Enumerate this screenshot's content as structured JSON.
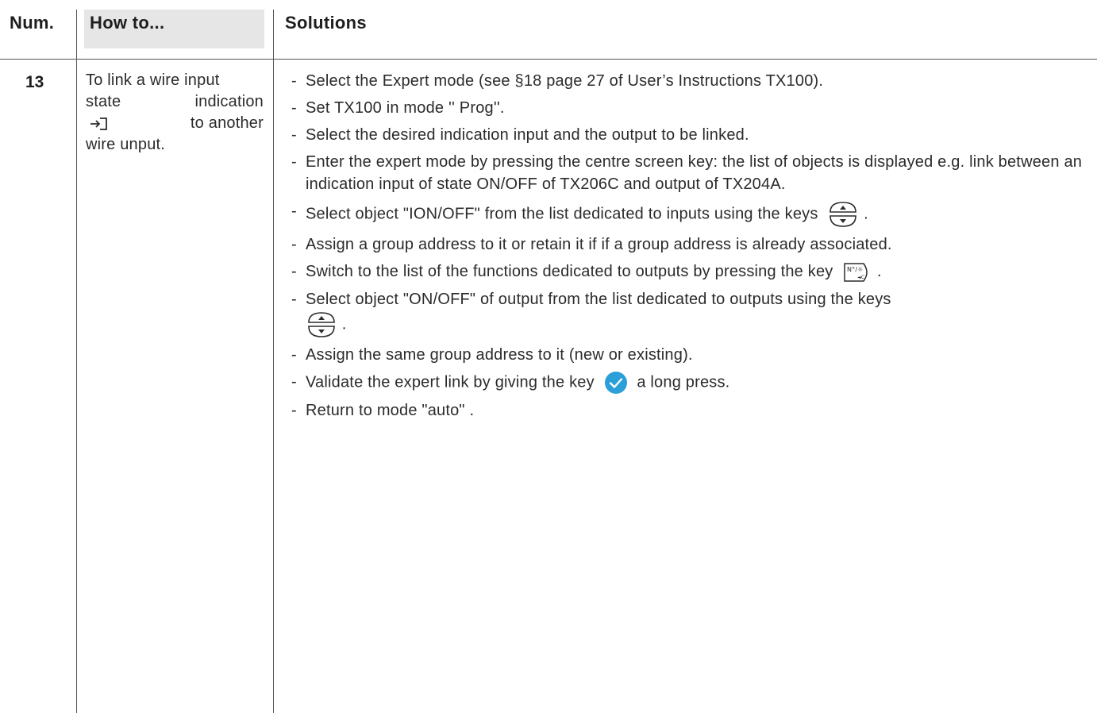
{
  "header": {
    "num": "Num.",
    "howto": "How to...",
    "solutions": "Solutions"
  },
  "row": {
    "num": "13",
    "howto_lines": [
      "To link a wire input",
      "state",
      "indication",
      "to another",
      "wire unput."
    ],
    "steps": [
      "Select the Expert mode (see §18 page 27 of User’s Instructions TX100).",
      "Set TX100 in mode '' Prog''.",
      "Select the desired indication input and the output to be linked.",
      "Enter the expert mode by pressing the centre screen key: the list of objects is displayed e.g. link between an indication input of state ON/OFF of TX206C and output of TX204A.",
      "Select object \"ION/OFF\" from the list dedicated to inputs using the keys",
      "Assign a group address to it or retain it if if a group address is already associated.",
      "Switch to the list of the functions dedicated to outputs by pressing the key",
      "Select object \"ON/OFF\" of output from the list dedicated to outputs using the keys",
      "Assign the same group address to it (new or existing).",
      "Validate the expert link by giving the key",
      "a long press.",
      "Return to mode \"auto\" ."
    ],
    "dash": "-",
    "period": ".",
    "icons": {
      "input": "input-arrow-icon",
      "updown": "up-down-keys-icon",
      "function": "function-key-icon",
      "validate": "checkmark-key-icon"
    },
    "function_key_text": "N°/☼",
    "colors": {
      "validate": "#2a9fd8",
      "header_bg": "#e6e6e6",
      "lines": "#555555"
    }
  }
}
